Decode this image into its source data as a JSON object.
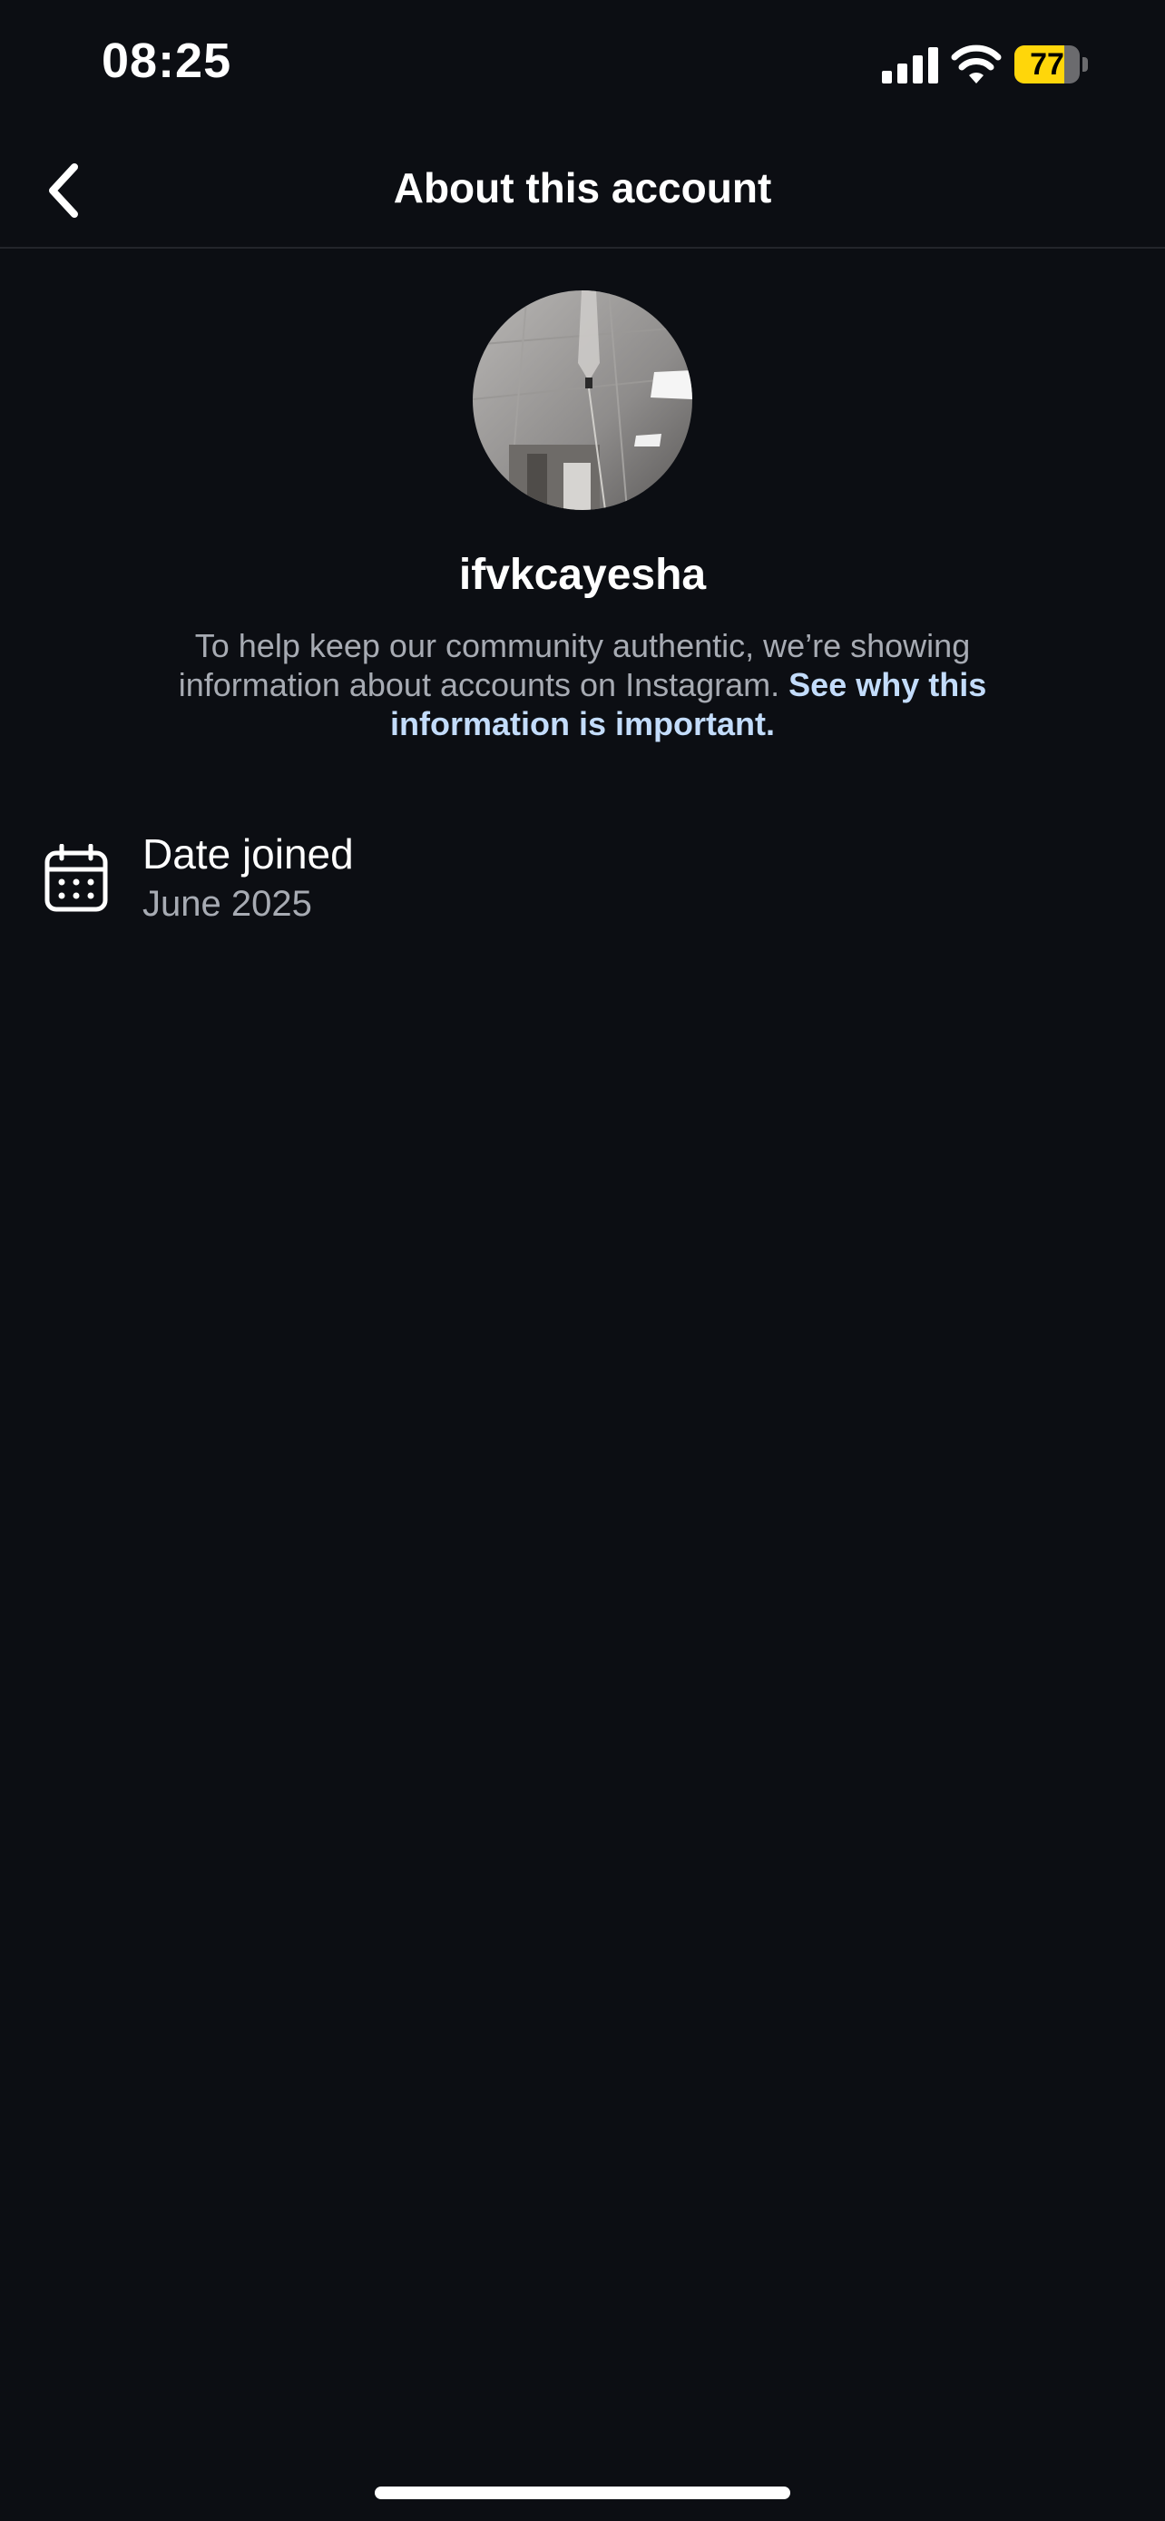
{
  "status_bar": {
    "time": "08:25",
    "battery_level": "77",
    "battery_fraction": 0.77,
    "battery_color": "#ffd60a",
    "icons": [
      "signal-icon",
      "wifi-icon",
      "battery-icon"
    ]
  },
  "header": {
    "title": "About this account",
    "back_icon": "chevron-left-icon"
  },
  "profile": {
    "username": "ifvkcayesha",
    "description": "To help keep our community authentic, we’re showing information about accounts on Instagram. ",
    "link_text": "See why this information is important."
  },
  "details": [
    {
      "icon": "calendar-icon",
      "label": "Date joined",
      "value": "June 2025"
    }
  ],
  "colors": {
    "background": "#0c0e13",
    "link": "#c3dcfb",
    "secondary_text": "#a7abb3"
  }
}
